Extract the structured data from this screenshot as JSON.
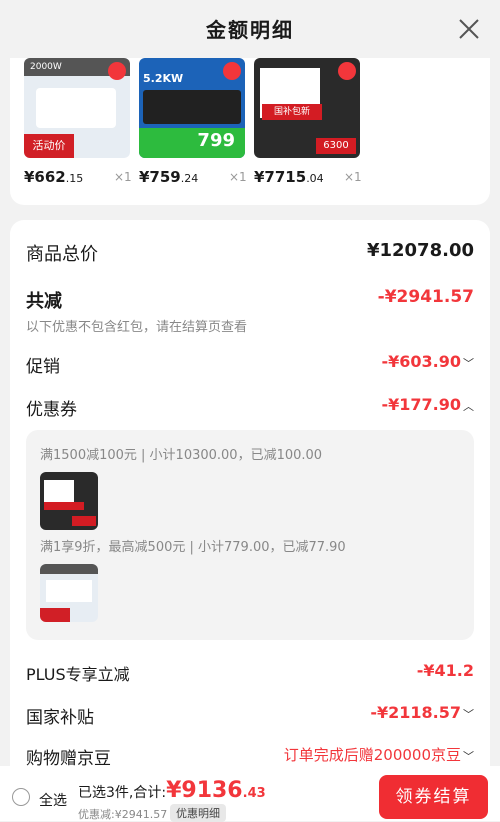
{
  "header": {
    "title": "金额明细",
    "close_icon": "close-icon"
  },
  "products": [
    {
      "price_main": "¥662",
      "price_dec": ".15",
      "qty": "×1",
      "badge": "活动价",
      "text": "2000W",
      "colors": [
        "#e7edf3",
        "#ffffff",
        "#d11f26"
      ]
    },
    {
      "price_main": "¥759",
      "price_dec": ".24",
      "qty": "×1",
      "badge": "799",
      "text": "5.2KW",
      "colors": [
        "#1c63b8",
        "#212121",
        "#2dbb3e"
      ]
    },
    {
      "price_main": "¥7715",
      "price_dec": ".04",
      "qty": "×1",
      "badge": "6300",
      "text": "国补包新",
      "colors": [
        "#2a2a2a",
        "#ffffff",
        "#d31c23"
      ]
    }
  ],
  "summary": {
    "goods_total_label": "商品总价",
    "goods_total_value": "¥12078.00",
    "reduce_label": "共减",
    "reduce_value": "-¥2941.57",
    "reduce_note": "以下优惠不包含红包，请在结算页查看",
    "promo_label": "促销",
    "promo_value": "-¥603.90",
    "coupon_label": "优惠券",
    "coupon_value": "-¥177.90",
    "coupon_line1": "满1500减100元 | 小计10300.00，已减100.00",
    "coupon_line2": "满1享9折，最高减500元 | 小计779.00，已减77.90",
    "plus_label": "PLUS专享立减",
    "plus_value": "-¥41.2",
    "subsidy_label": "国家补贴",
    "subsidy_value": "-¥2118.57",
    "beans_label": "购物赠京豆",
    "beans_value": "订单完成后赠200000京豆"
  },
  "bottom": {
    "select_all": "全选",
    "selected": "已选3件,合计:",
    "total_main": "¥9136",
    "total_dec": ".43",
    "discount": "优惠减:¥2941.57",
    "detail_tag": "优惠明细",
    "checkout": "领券结算"
  },
  "colors": {
    "accent": "#f2363b",
    "background": "#f2f2f2"
  }
}
